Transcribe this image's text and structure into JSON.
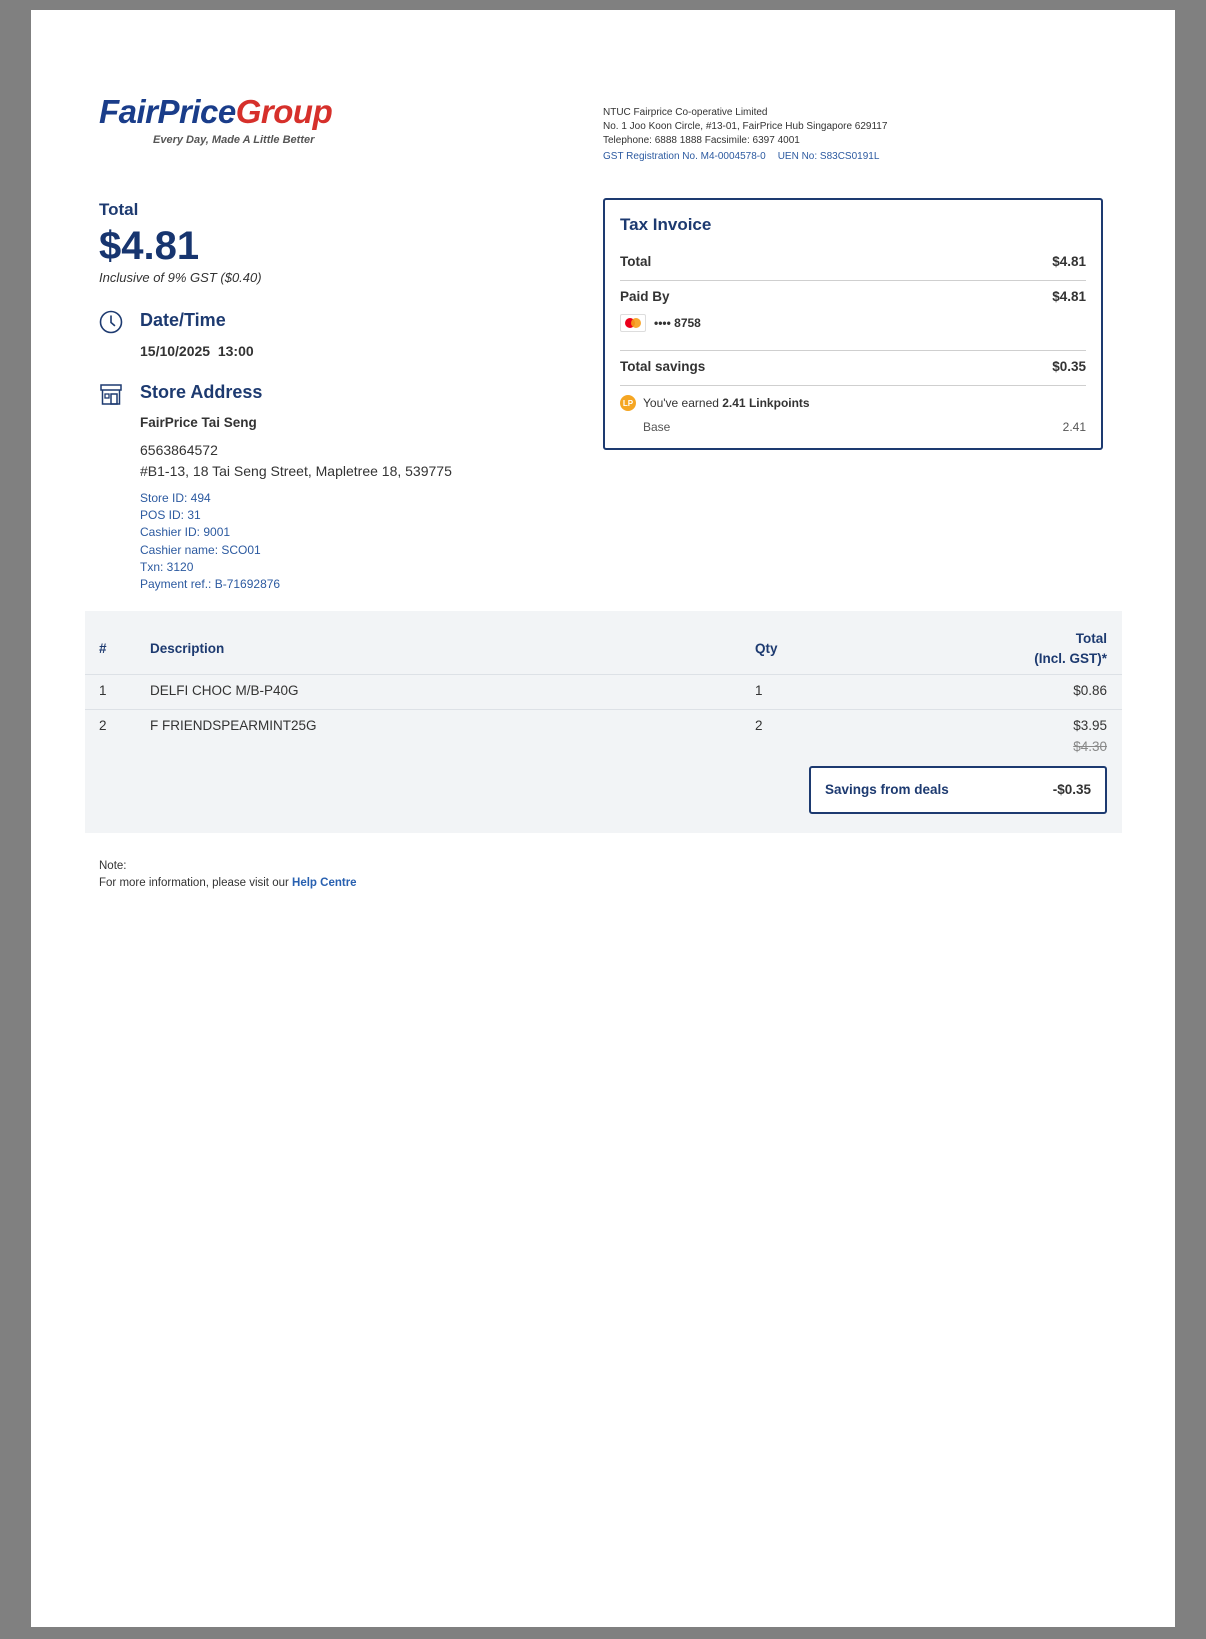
{
  "brand": {
    "logo_part1": "FairPrice",
    "logo_part2": "Group",
    "tagline": "Every Day, Made A Little Better",
    "colors": {
      "navy": "#1d3a70",
      "red": "#d6302b",
      "link": "#2860b0"
    }
  },
  "company": {
    "name": "NTUC Fairprice Co-operative Limited",
    "address": "No. 1 Joo Koon Circle, #13-01, FairPrice Hub Singapore 629117",
    "contact": "Telephone: 6888 1888 Facsimile: 6397 4001",
    "gst_reg": "GST Registration No. M4-0004578-0",
    "uen": "UEN No: S83CS0191L"
  },
  "summary": {
    "total_label": "Total",
    "total_amount": "$4.81",
    "gst_note": "Inclusive of 9% GST ($0.40)"
  },
  "datetime": {
    "title": "Date/Time",
    "value": "15/10/2025  13:00"
  },
  "store": {
    "title": "Store Address",
    "name": "FairPrice Tai Seng",
    "phone": "6563864572",
    "address": "#B1-13, 18 Tai Seng Street, Mapletree 18, 539775",
    "meta": [
      "Store ID: 494",
      "POS ID: 31",
      "Cashier ID: 9001",
      "Cashier name: SCO01",
      "Txn: 3120",
      "Payment ref.: B-71692876"
    ]
  },
  "tax_invoice": {
    "title": "Tax Invoice",
    "total_label": "Total",
    "total_value": "$4.81",
    "paid_by_label": "Paid By",
    "paid_by_value": "$4.81",
    "card_icon": "mastercard-icon",
    "card_number": "•••• 8758",
    "savings_label": "Total savings",
    "savings_value": "$0.35",
    "linkpoints_icon_text": "LP",
    "linkpoints_prefix": "You've earned ",
    "linkpoints_value": "2.41 Linkpoints",
    "base_label": "Base",
    "base_value": "2.41"
  },
  "items_table": {
    "headers": {
      "index": "#",
      "description": "Description",
      "qty": "Qty",
      "total_line1": "Total",
      "total_line2": "(Incl. GST)*"
    },
    "rows": [
      {
        "index": "1",
        "description": "DELFI CHOC M/B-P40G",
        "qty": "1",
        "total": "$0.86",
        "original": ""
      },
      {
        "index": "2",
        "description": "F FRIENDSPEARMINT25G",
        "qty": "2",
        "total": "$3.95",
        "original": "$4.30"
      }
    ],
    "savings_label": "Savings from deals",
    "savings_value": "-$0.35"
  },
  "note": {
    "label": "Note:",
    "text": "For more information, please visit our ",
    "link": "Help Centre"
  }
}
